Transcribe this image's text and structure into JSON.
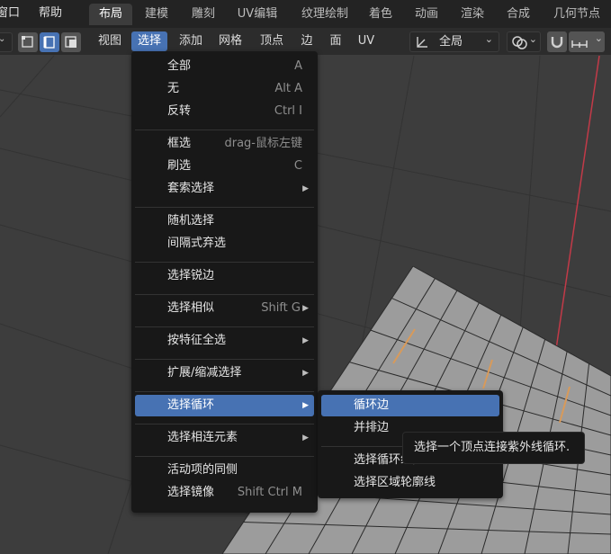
{
  "topbar": {
    "menus": [
      "窗口",
      "帮助"
    ],
    "workspaces": [
      "布局",
      "建模",
      "雕刻",
      "UV编辑",
      "纹理绘制",
      "着色",
      "动画",
      "渲染",
      "合成",
      "几何节点"
    ]
  },
  "header": {
    "menus": [
      "视图",
      "选择",
      "添加",
      "网格",
      "顶点",
      "边",
      "面",
      "UV"
    ],
    "transform_orientation": "全局"
  },
  "select_menu": {
    "items": [
      {
        "label": "全部",
        "shortcut": "A"
      },
      {
        "label": "无",
        "shortcut": "Alt A"
      },
      {
        "label": "反转",
        "shortcut": "Ctrl I"
      },
      {
        "label": "框选",
        "shortcut": "drag-鼠标左键"
      },
      {
        "label": "刷选",
        "shortcut": "C"
      },
      {
        "label": "套索选择",
        "shortcut": ""
      },
      {
        "label": "随机选择",
        "shortcut": ""
      },
      {
        "label": "间隔式弃选",
        "shortcut": ""
      },
      {
        "label": "选择锐边",
        "shortcut": ""
      },
      {
        "label": "选择相似",
        "shortcut": "Shift G"
      },
      {
        "label": "按特征全选",
        "shortcut": ""
      },
      {
        "label": "扩展/缩减选择",
        "shortcut": ""
      },
      {
        "label": "选择循环",
        "shortcut": ""
      },
      {
        "label": "选择相连元素",
        "shortcut": ""
      },
      {
        "label": "活动项的同侧",
        "shortcut": ""
      },
      {
        "label": "选择镜像",
        "shortcut": "Shift Ctrl M"
      }
    ]
  },
  "loop_submenu": {
    "items": [
      "循环边",
      "并排边",
      "选择循环线内侧区域",
      "选择区域轮廓线"
    ]
  },
  "tooltip": "选择一个顶点连接紫外线循环.",
  "colors": {
    "accent": "#4772b3",
    "mesh": "#9c9c9c",
    "red_axis": "#c23a48"
  }
}
